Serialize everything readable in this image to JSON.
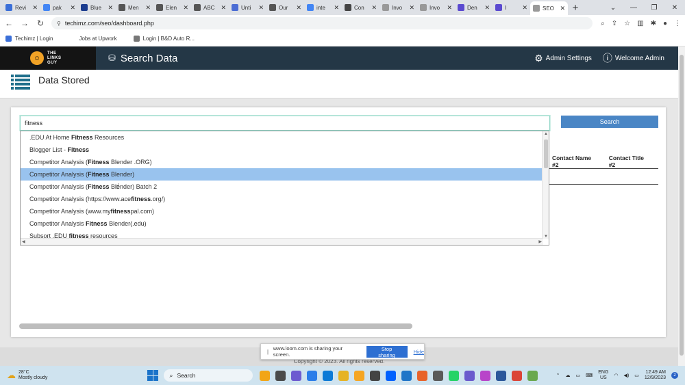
{
  "browser": {
    "tabs": [
      {
        "label": "Revi",
        "color": "#3b6fd8"
      },
      {
        "label": "pak",
        "color": "#4285f4"
      },
      {
        "label": "Blue",
        "color": "#1c3d8f"
      },
      {
        "label": "Men",
        "color": "#555555"
      },
      {
        "label": "Elen",
        "color": "#555555"
      },
      {
        "label": "ABC",
        "color": "#555555"
      },
      {
        "label": "Unti",
        "color": "#4a6cd4"
      },
      {
        "label": "Our",
        "color": "#555555"
      },
      {
        "label": "inte",
        "color": "#4285f4"
      },
      {
        "label": "Con",
        "color": "#444444"
      },
      {
        "label": "Invo",
        "color": "#999999"
      },
      {
        "label": "Invo",
        "color": "#999999"
      },
      {
        "label": "Den",
        "color": "#5b4ad0"
      },
      {
        "label": "I",
        "color": "#5b4ad0"
      },
      {
        "label": "SEO",
        "color": "#999999"
      }
    ],
    "active_tab_index": 14,
    "new_tab": "+",
    "url": "techimz.com/seo/dashboard.php",
    "bookmarks": [
      {
        "label": "Techimz | Login",
        "color": "#3b6fd8"
      },
      {
        "label": "Jobs at Upwork",
        "color": "#ffffff"
      },
      {
        "label": "Login | B&D Auto R...",
        "color": "#777777"
      }
    ]
  },
  "app": {
    "logo_line1": "THE",
    "logo_line2": "LINKS",
    "logo_line3": "GUY",
    "title": "Search Data",
    "admin_settings": "Admin Settings",
    "welcome": "Welcome Admin"
  },
  "page": {
    "heading": "Data Stored",
    "search_value": "fitness",
    "search_button": "Search",
    "columns": [
      "Contact Name #2",
      "Contact Title #2"
    ]
  },
  "autocomplete": {
    "highlighted_index": 3,
    "items": [
      {
        "before": ".EDU At Home ",
        "match": "Fitness",
        "after": " Resources"
      },
      {
        "before": "Blogger List - ",
        "match": "Fitness",
        "after": ""
      },
      {
        "before": "Competitor Analysis (",
        "match": "Fitness",
        "after": " Blender .ORG)"
      },
      {
        "before": "Competitor Analysis (",
        "match": "Fitness",
        "after": " Blender)"
      },
      {
        "before": "Competitor Analysis (",
        "match": "Fitness",
        "after": " Blender) Batch 2"
      },
      {
        "before": "Competitor Analysis (https://www.ace",
        "match": "fitness",
        "after": ".org/)"
      },
      {
        "before": "Competitor Analysis (www.my",
        "match": "fitness",
        "after": "pal.com)"
      },
      {
        "before": "Competitor Analysis ",
        "match": "Fitness",
        "after": " Blender(.edu)"
      },
      {
        "before": "Subsort .EDU ",
        "match": "fitness",
        "after": " resources"
      }
    ]
  },
  "footer": {
    "copyright": "Copyright © 2023. All rights reserved."
  },
  "loom": {
    "message": "www.loom.com is sharing your screen.",
    "stop": "Stop sharing",
    "hide": "Hide"
  },
  "taskbar": {
    "temperature": "28°C",
    "weather": "Mostly cloudy",
    "search": "Search",
    "lang1": "ENG",
    "lang2": "US",
    "time": "12:49 AM",
    "date": "12/9/2023",
    "notifications": "2",
    "app_colors": [
      "#f2a516",
      "#4a4a4a",
      "#6d5bd0",
      "#2b7de9",
      "#0c7ad6",
      "#e6b324",
      "#f5a623",
      "#444444",
      "#0061fe",
      "#1f75c8",
      "#e8632a",
      "#5a5a5a",
      "#25d366",
      "#6a5acd",
      "#b845c9",
      "#2b579a",
      "#db4437",
      "#6aa84f"
    ]
  }
}
